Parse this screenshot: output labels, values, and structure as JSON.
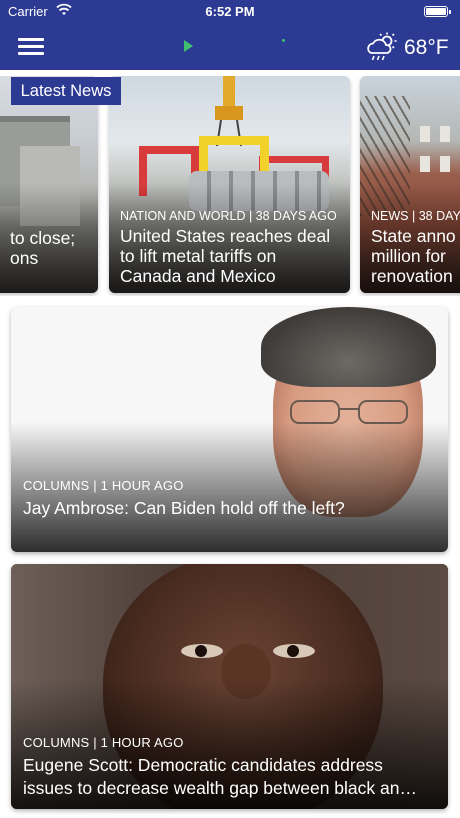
{
  "status_bar": {
    "carrier": "Carrier",
    "time": "6:52 PM"
  },
  "nav": {
    "weather_icon": "partly-cloudy-rain-icon",
    "temperature": "68°F",
    "accent_color": "#2d3a93"
  },
  "badge": {
    "label": "Latest News"
  },
  "carousel": [
    {
      "category": "",
      "title": "to close;\nons"
    },
    {
      "category": "NATION AND WORLD | 38 DAYS AGO",
      "title": "United States reaches deal to lift metal tariffs on Canada and Mexico"
    },
    {
      "category": "NEWS | 38 DAY",
      "title": "State anno million for renovation"
    }
  ],
  "stories": [
    {
      "category": "COLUMNS | 1 HOUR AGO",
      "title": "Jay Ambrose: Can Biden hold off the left?"
    },
    {
      "category": "COLUMNS | 1 HOUR AGO",
      "title": "Eugene Scott: Democratic candidates address issues to decrease wealth gap between black an…"
    }
  ]
}
